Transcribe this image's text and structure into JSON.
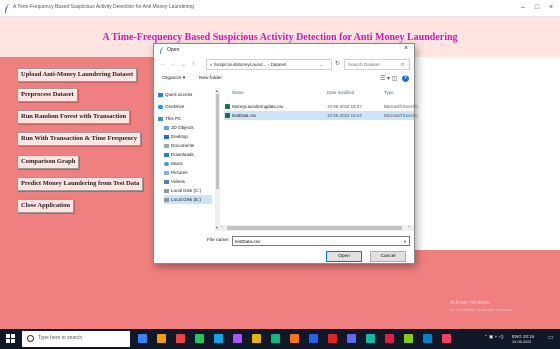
{
  "window": {
    "title": "A Time-Frequency Based Suspicious Activity Detection for Anti Money Laundering",
    "min_glyph": "–",
    "max_glyph": "□",
    "close_glyph": "×"
  },
  "app": {
    "heading": "A Time-Frequency Based Suspicious Activity Detection for Anti Money Laundering",
    "buttons": [
      "Upload Anti-Money Laundering Dataset",
      "Preprocess Dataset",
      "Run Random Forest with Transaction",
      "Run With Transaction & Time Frequency",
      "Comparison Graph",
      "Predict Money Laundering from Test Data",
      "Close Application"
    ]
  },
  "dialog": {
    "title": "Open",
    "close_glyph": "×",
    "back_glyph": "←",
    "forward_glyph": "→",
    "recent_glyph": "⌄",
    "up_glyph": "↑",
    "address": "« SuspiciousMoneyLaund... › Dataset",
    "address_chevron": "⌄",
    "refresh_glyph": "↻",
    "search_placeholder": "Search Dataset",
    "search_glyph": "⌕",
    "organize": "Organize ▾",
    "new_folder": "New folder",
    "view_glyph": "☰ ▾  ◫",
    "help_glyph": "?",
    "nav": [
      {
        "label": "Quick access",
        "sub": false
      },
      {
        "label": "OneDrive",
        "sub": false
      },
      {
        "label": "This PC",
        "sub": false
      },
      {
        "label": "3D Objects",
        "sub": true
      },
      {
        "label": "Desktop",
        "sub": true
      },
      {
        "label": "Documents",
        "sub": true
      },
      {
        "label": "Downloads",
        "sub": true
      },
      {
        "label": "Music",
        "sub": true
      },
      {
        "label": "Pictures",
        "sub": true
      },
      {
        "label": "Videos",
        "sub": true
      },
      {
        "label": "Local Disk (C:)",
        "sub": true
      },
      {
        "label": "Local Disk (E:)",
        "sub": true
      }
    ],
    "columns": {
      "name": "Name",
      "date": "Date modified",
      "type": "Type"
    },
    "files": [
      {
        "name": "MoneyLaunderingdata.csv",
        "date": "10-06-2022 19:37",
        "type": "Microsoft Excel C"
      },
      {
        "name": "testData.csv",
        "date": "10-06-2022 19:44",
        "type": "Microsoft Excel C"
      }
    ],
    "selected_file_index": 1,
    "filename_label": "File name:",
    "filename_value": "testData.csv",
    "open_label": "Open",
    "cancel_label": "Cancel"
  },
  "watermark": {
    "line1": "Activate Windows",
    "line2": "Go to Settings to activate Windows."
  },
  "taskbar": {
    "search_placeholder": "Type here to search",
    "tray_text": "ENG 20:16",
    "tray_date": "10-06-2022",
    "icon_colors": [
      "#3b82f6",
      "#f59e0b",
      "#ef4444",
      "#22c55e",
      "#0ea5e9",
      "#a855f7",
      "#eab308",
      "#10b981",
      "#f97316",
      "#2563eb",
      "#dc2626",
      "#6366f1",
      "#14b8a6",
      "#e11d48",
      "#84cc16",
      "#0284c7",
      "#f43f5e"
    ]
  },
  "colors": {
    "app_background": "#f08080",
    "heading_band": "#ffe4e1",
    "heading_text": "#c51fb6",
    "button_background": "#ffe4e1",
    "selection": "#cce4f7",
    "taskbar": "#101828"
  }
}
